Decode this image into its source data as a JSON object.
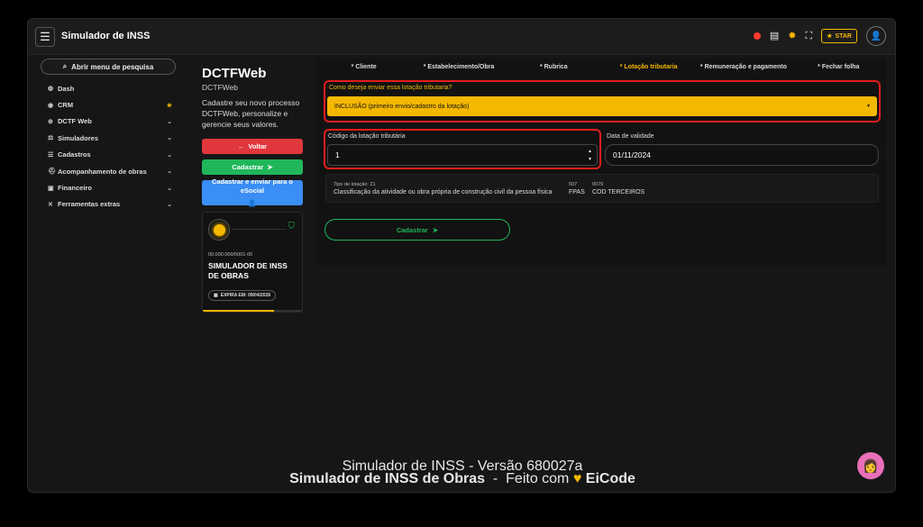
{
  "app": {
    "title": "Simulador de INSS"
  },
  "topbar": {
    "star_label": "STAR"
  },
  "sidebar": {
    "search_label": "Abrir menu de pesquisa",
    "items": [
      {
        "label": "Dash",
        "icon": "dashboard-icon",
        "trail": ""
      },
      {
        "label": "CRM",
        "icon": "crm-icon",
        "trail": "star"
      },
      {
        "label": "DCTF Web",
        "icon": "globe-icon",
        "trail": "chevron"
      },
      {
        "label": "Simuladores",
        "icon": "scale-icon",
        "trail": "chevron"
      },
      {
        "label": "Cadastros",
        "icon": "list-icon",
        "trail": "chevron"
      },
      {
        "label": "Acompanhamento de obras",
        "icon": "worker-icon",
        "trail": "chevron"
      },
      {
        "label": "Financeiro",
        "icon": "money-icon",
        "trail": "chevron"
      },
      {
        "label": "Ferramentas extras",
        "icon": "tools-icon",
        "trail": "chevron"
      }
    ]
  },
  "page": {
    "title": "DCTFWeb",
    "subtitle": "DCTFWeb",
    "description": "Cadastre seu novo processo DCTFWeb, personalize e gerencie seus valores.",
    "back_label": "Voltar",
    "save_label": "Cadastrar",
    "esocial_label": "Cadastrar e enviar para o eSocial"
  },
  "card": {
    "cnpj": "00.000.000/0001-00",
    "name": "SIMULADOR DE INSS DE OBRAS",
    "expiry": "EXPIRA EM: 09/04/2026",
    "progress": 0.72
  },
  "tabs": [
    {
      "label": "* Cliente",
      "active": false
    },
    {
      "label": "* Estabelecimento/Obra",
      "active": false
    },
    {
      "label": "* Rubrica",
      "active": false
    },
    {
      "label": "* Lotação tributaria",
      "active": true
    },
    {
      "label": "* Remuneração e pagamento",
      "active": false
    },
    {
      "label": "* Fechar folha",
      "active": false
    }
  ],
  "form": {
    "send_label": "Como deseja enviar essa lotação tributaria?",
    "send_value": "INCLUSÃO (primeiro envio/cadastro da lotação)",
    "code_label": "Código da lotação tributária",
    "code_value": "1",
    "validity_label": "Data de validade",
    "validity_value": "01/11/2024",
    "info": {
      "tipo_label": "Tipo de lotação: 21",
      "tipo_value": "Classificação da atividade ou obra própria de construção civil da pessoa física",
      "fpas_code": "507",
      "fpas_label": "FPAS",
      "terceiros_code": "0079",
      "terceiros_label": "COD TERCEIROS"
    },
    "submit_label": "Cadastrar"
  },
  "footer": {
    "version": "Simulador de INSS - Versão 680027a",
    "brand": "Simulador de INSS de Obras",
    "sep": "-",
    "made_with": "Feito com",
    "author": "EiCode"
  }
}
